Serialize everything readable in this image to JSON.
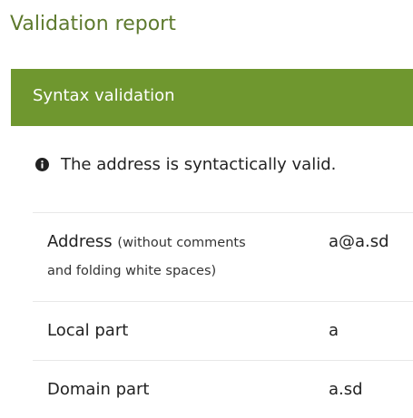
{
  "page": {
    "title": "Validation report"
  },
  "section": {
    "title": "Syntax validation",
    "status_icon": "info-icon",
    "status_text": "The address is syntactically valid."
  },
  "colors": {
    "title": "#5e7a2e",
    "header_bg": "#6f972f",
    "header_text": "#ffffff"
  },
  "details": {
    "address": {
      "label": "Address",
      "note_line1": "(without comments",
      "note_line2": "and folding white spaces)",
      "value": "a@a.sd"
    },
    "local_part": {
      "label": "Local part",
      "value": "a"
    },
    "domain_part": {
      "label": "Domain part",
      "value": "a.sd"
    }
  }
}
